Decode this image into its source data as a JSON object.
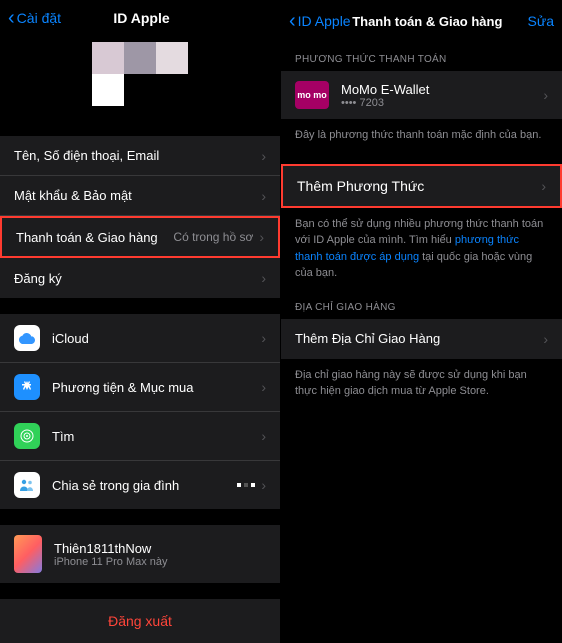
{
  "left": {
    "nav": {
      "back": "Cài đặt",
      "title": "ID Apple"
    },
    "rows": {
      "contact": "Tên, Số điện thoại, Email",
      "security": "Mật khẩu & Bảo mật",
      "payment": "Thanh toán & Giao hàng",
      "payment_value": "Có trong hồ sơ",
      "subscriptions": "Đăng ký",
      "icloud": "iCloud",
      "media": "Phương tiện & Mục mua",
      "find": "Tìm",
      "family": "Chia sẻ trong gia đình"
    },
    "device": {
      "name": "Thiên1811thNow",
      "sub": "iPhone 11 Pro Max này"
    },
    "signout": "Đăng xuất"
  },
  "right": {
    "nav": {
      "back": "ID Apple",
      "title": "Thanh toán & Giao hàng",
      "edit": "Sửa"
    },
    "section_payment": "PHƯƠNG THỨC THANH TOÁN",
    "payment": {
      "brand": "mo mo",
      "name": "MoMo E-Wallet",
      "masked": "•••• 7203"
    },
    "payment_footer": "Đây là phương thức thanh toán mặc định của bạn.",
    "add_method": "Thêm Phương Thức",
    "add_footer_a": "Bạn có thể sử dụng nhiều phương thức thanh toán với ID Apple của mình. Tìm hiểu ",
    "add_footer_link": "phương thức thanh toán được áp dụng",
    "add_footer_b": " tại quốc gia hoặc vùng của bạn.",
    "section_shipping": "ĐỊA CHỈ GIAO HÀNG",
    "add_shipping": "Thêm Địa Chỉ Giao Hàng",
    "shipping_footer": "Địa chỉ giao hàng này sẽ được sử dụng khi bạn thực hiện giao dịch mua từ Apple Store."
  }
}
